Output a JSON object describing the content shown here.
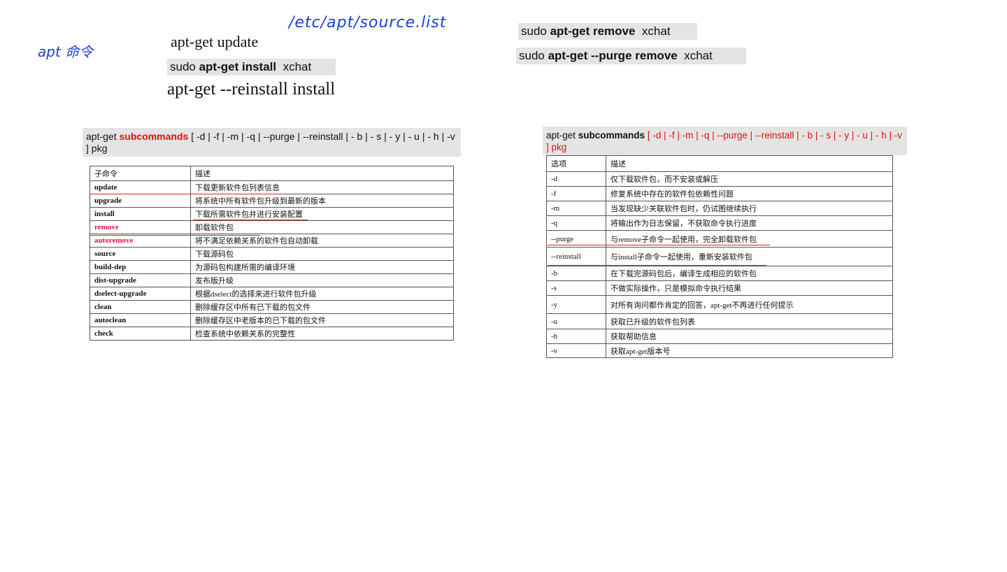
{
  "handwriting": {
    "path_note": "/etc/apt/source.list",
    "apt_note": "apt 命令"
  },
  "commands": {
    "update": "apt-get update",
    "install": {
      "prefix": "sudo ",
      "cmd": "apt-get install",
      "arg": "xchat"
    },
    "reinstall": "apt-get --reinstall install",
    "remove": {
      "prefix": "sudo ",
      "cmd": "apt-get remove",
      "arg": "xchat"
    },
    "purge_remove": {
      "prefix": "sudo ",
      "cmd": "apt-get --purge remove",
      "arg": "xchat"
    }
  },
  "left_synopsis": {
    "prefix": "apt-get ",
    "keyword": "subcommands",
    "options": "[ -d | -f | -m | -q | --purge | --reinstall | - b | - s | - y | - u | - h | -v ]  pkg"
  },
  "left_table": {
    "headers": [
      "子命令",
      "描述"
    ],
    "rows": [
      [
        "update",
        "下载更新软件包列表信息"
      ],
      [
        "upgrade",
        "将系统中所有软件包升级到最新的版本"
      ],
      [
        "install",
        "下载所需软件包并进行安装配置"
      ],
      [
        "remove",
        "卸载软件包"
      ],
      [
        "autoremove",
        "将不满足依赖关系的软件包自动卸载"
      ],
      [
        "source",
        "下载源码包"
      ],
      [
        "build-dep",
        "为源码包构建所需的编译环境"
      ],
      [
        "dist-upgrade",
        "发布版升级"
      ],
      [
        "dselect-upgrade",
        "根据dselect的选择来进行软件包升级"
      ],
      [
        "clean",
        "删除缓存区中所有已下载的包文件"
      ],
      [
        "autoclean",
        "删除缓存区中老版本的已下载的包文件"
      ],
      [
        "check",
        "检查系统中依赖关系的完整性"
      ]
    ]
  },
  "right_synopsis": {
    "prefix": "apt-get ",
    "keyword": "subcommands",
    "options": "[ -d | -f | -m | -q | --purge | --reinstall | - b | - s | - y | - u | - h | -v ]  pkg"
  },
  "right_table": {
    "headers": [
      "选项",
      "描述"
    ],
    "rows": [
      [
        "-d",
        "仅下载软件包，而不安装或解压"
      ],
      [
        "-f",
        "修复系统中存在的软件包依赖性问题"
      ],
      [
        "-m",
        "当发现缺少关联软件包时，仍试图继续执行"
      ],
      [
        "-q",
        "将输出作为日志保留，不获取命令执行进度"
      ],
      [
        "--purge",
        "与remove子命令一起使用，完全卸载软件包"
      ],
      [
        "--reinstall",
        "与install子命令一起使用，重新安装软件包"
      ],
      [
        "-b",
        "在下载完源码包后，编译生成相应的软件包"
      ],
      [
        "-s",
        "不做实际操作，只是模拟命令执行结果"
      ],
      [
        "-y",
        "对所有询问都作肯定的回答，apt-get不再进行任何提示"
      ],
      [
        "-u",
        "获取已升级的软件包列表"
      ],
      [
        "-h",
        "获取帮助信息"
      ],
      [
        "-v",
        "获取apt-get版本号"
      ]
    ]
  },
  "colors": {
    "highlight_bg": "#e4e4e4",
    "red": "#e31010",
    "pink": "#e0105a",
    "ink": "#1a3fd6"
  }
}
